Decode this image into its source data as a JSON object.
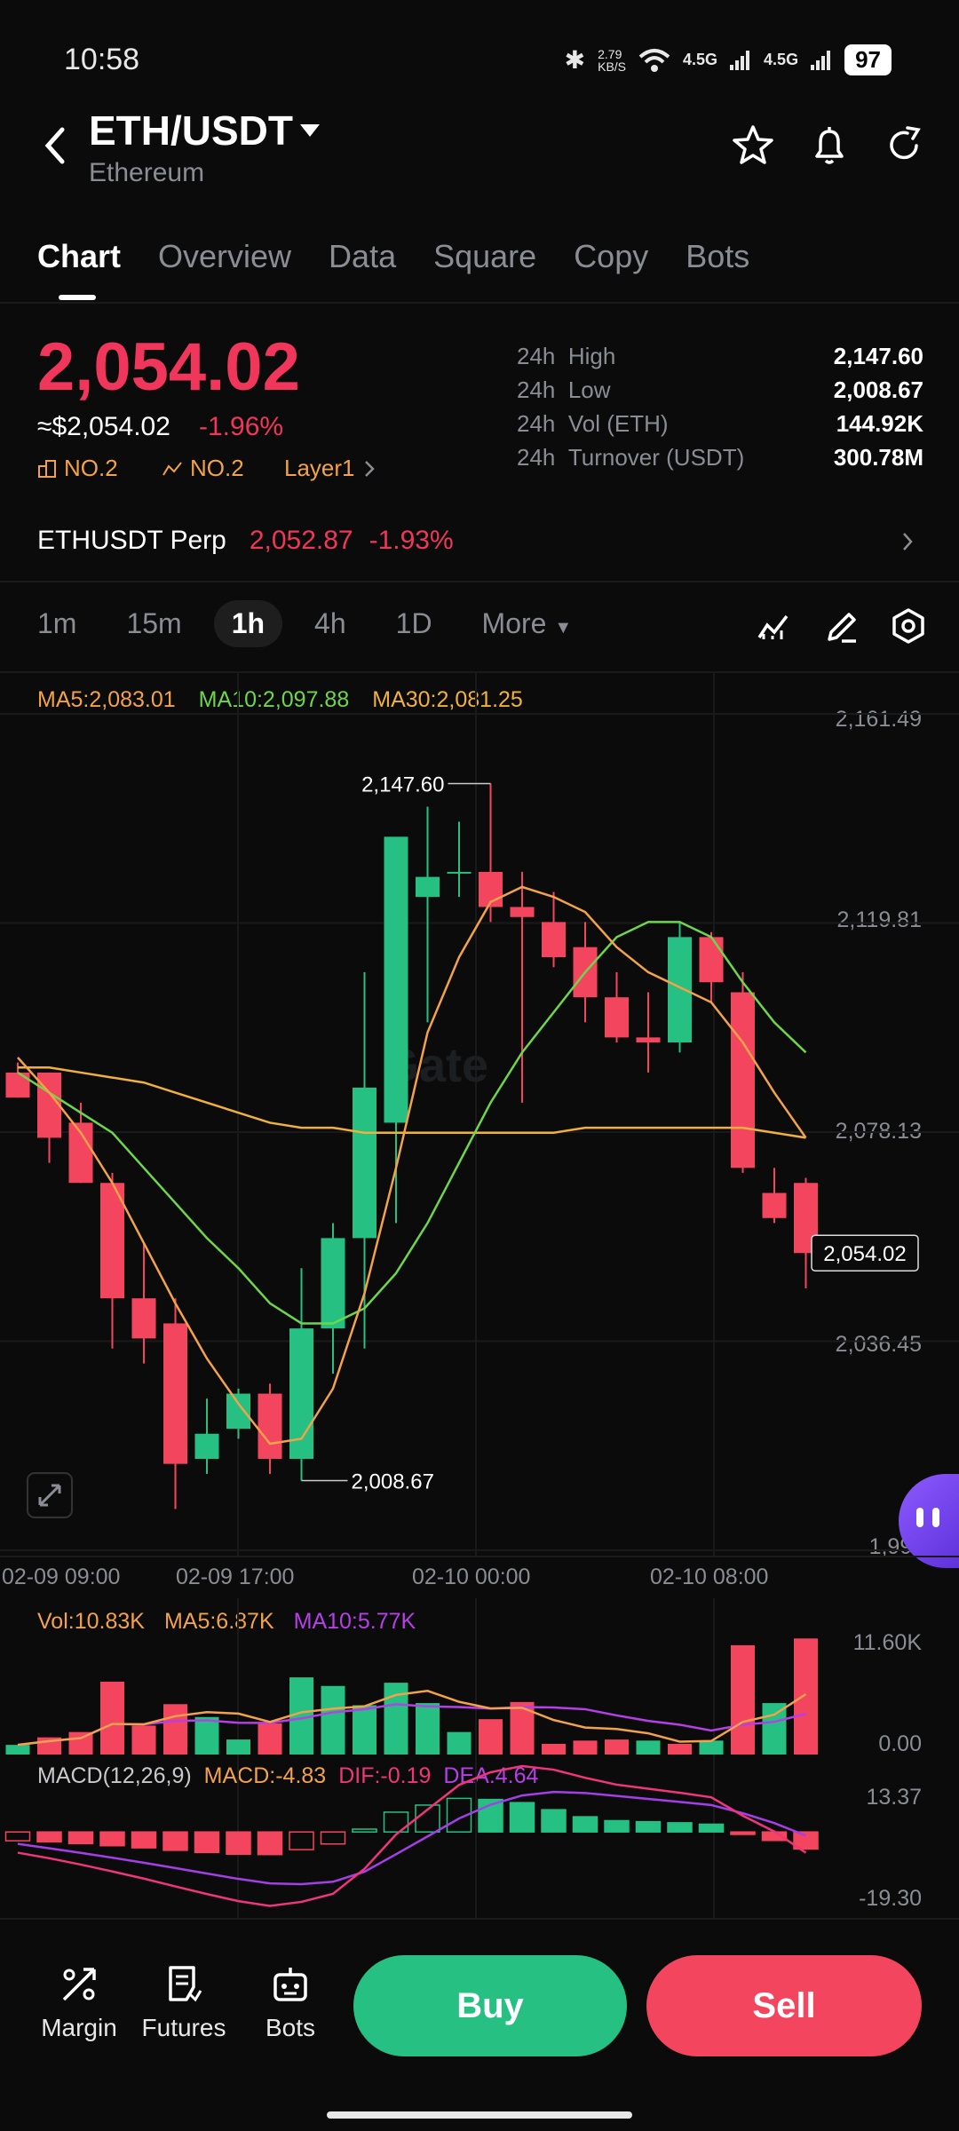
{
  "status_bar": {
    "time": "10:58",
    "speed": "2.79",
    "speed_unit": "KB/S",
    "network1": "4.5G",
    "network2": "4.5G",
    "battery": "97"
  },
  "header": {
    "pair": "ETH/USDT",
    "name": "Ethereum"
  },
  "tabs": [
    "Chart",
    "Overview",
    "Data",
    "Square",
    "Copy",
    "Bots"
  ],
  "active_tab": "Chart",
  "price": {
    "last": "2,054.02",
    "usd": "≈$2,054.02",
    "change": "-1.96%",
    "rank1": "NO.2",
    "rank2": "NO.2",
    "category": "Layer1"
  },
  "stats": [
    {
      "period": "24h",
      "label": "High",
      "value": "2,147.60"
    },
    {
      "period": "24h",
      "label": "Low",
      "value": "2,008.67"
    },
    {
      "period": "24h",
      "label": "Vol (ETH)",
      "value": "144.92K"
    },
    {
      "period": "24h",
      "label": "Turnover (USDT)",
      "value": "300.78M"
    }
  ],
  "perp": {
    "name": "ETHUSDT Perp",
    "price": "2,052.87",
    "change": "-1.93%"
  },
  "intervals": [
    "1m",
    "15m",
    "1h",
    "4h",
    "1D",
    "More"
  ],
  "active_interval": "1h",
  "ma_legend": {
    "ma5": "MA5:2,083.01",
    "ma10": "MA10:2,097.88",
    "ma30": "MA30:2,081.25"
  },
  "watermark": "Gate",
  "colors": {
    "up": "#25c082",
    "down": "#f4455f",
    "ma5": "#f2a24a",
    "ma10": "#6ed64a",
    "ma30": "#f0b13c",
    "dea": "#a43fe8",
    "dif": "#f0367a"
  },
  "chart_data": [
    {
      "type": "candlestick",
      "price_axis_ticks": [
        "2,161.49",
        "2,119.81",
        "2,078.13",
        "2,036.45",
        "1,994.7"
      ],
      "time_axis_ticks": [
        "02-09 09:00",
        "02-09 17:00",
        "02-10 00:00",
        "02-10 08:00"
      ],
      "ylim": [
        1994.77,
        2161.49
      ],
      "high_label": "2,147.60",
      "low_label": "2,008.67",
      "last_price_label": "2,054.02",
      "candles": [
        {
          "o": 2090,
          "h": 2092,
          "l": 2085,
          "c": 2085
        },
        {
          "o": 2090,
          "h": 2090,
          "l": 2072,
          "c": 2077
        },
        {
          "o": 2080,
          "h": 2084,
          "l": 2068,
          "c": 2068
        },
        {
          "o": 2068,
          "h": 2070,
          "l": 2035,
          "c": 2045
        },
        {
          "o": 2045,
          "h": 2056,
          "l": 2032,
          "c": 2037
        },
        {
          "o": 2040,
          "h": 2045,
          "l": 2003,
          "c": 2012
        },
        {
          "o": 2013,
          "h": 2025,
          "l": 2010,
          "c": 2018
        },
        {
          "o": 2019,
          "h": 2027,
          "l": 2017,
          "c": 2026
        },
        {
          "o": 2026,
          "h": 2028,
          "l": 2010,
          "c": 2013
        },
        {
          "o": 2013,
          "h": 2051,
          "l": 2008.67,
          "c": 2039
        },
        {
          "o": 2039,
          "h": 2060,
          "l": 2030,
          "c": 2057
        },
        {
          "o": 2057,
          "h": 2110,
          "l": 2035,
          "c": 2087
        },
        {
          "o": 2080,
          "h": 2136,
          "l": 2060,
          "c": 2137
        },
        {
          "o": 2125,
          "h": 2143,
          "l": 2100,
          "c": 2129
        },
        {
          "o": 2130,
          "h": 2140,
          "l": 2125,
          "c": 2130
        },
        {
          "o": 2130,
          "h": 2147.6,
          "l": 2120,
          "c": 2123
        },
        {
          "o": 2123,
          "h": 2130,
          "l": 2084,
          "c": 2121
        },
        {
          "o": 2120,
          "h": 2126,
          "l": 2111,
          "c": 2113
        },
        {
          "o": 2115,
          "h": 2120,
          "l": 2100,
          "c": 2105
        },
        {
          "o": 2105,
          "h": 2110,
          "l": 2096,
          "c": 2097
        },
        {
          "o": 2097,
          "h": 2106,
          "l": 2090,
          "c": 2096
        },
        {
          "o": 2096,
          "h": 2120,
          "l": 2094,
          "c": 2117
        },
        {
          "o": 2117,
          "h": 2118,
          "l": 2104,
          "c": 2108
        },
        {
          "o": 2106,
          "h": 2110,
          "l": 2070,
          "c": 2071
        },
        {
          "o": 2066,
          "h": 2071,
          "l": 2060,
          "c": 2061
        },
        {
          "o": 2068,
          "h": 2069,
          "l": 2047,
          "c": 2054.02
        }
      ],
      "ma5": [
        2093,
        2086,
        2078,
        2068,
        2056,
        2044,
        2033,
        2024,
        2016,
        2017,
        2027,
        2046,
        2071,
        2098,
        2113,
        2124,
        2127,
        2125,
        2122,
        2115,
        2110,
        2107,
        2104,
        2096,
        2086,
        2077
      ],
      "ma10": [
        2090,
        2086,
        2082,
        2078,
        2071,
        2064,
        2057,
        2051,
        2044,
        2040,
        2040,
        2043,
        2050,
        2060,
        2072,
        2084,
        2094,
        2102,
        2110,
        2117,
        2120,
        2120,
        2117,
        2108,
        2100,
        2094
      ],
      "ma30": [
        2091,
        2091,
        2090,
        2089,
        2088,
        2086,
        2084,
        2082,
        2080,
        2079,
        2079,
        2078,
        2078,
        2078,
        2078,
        2078,
        2078,
        2078,
        2079,
        2079,
        2079,
        2079,
        2079,
        2079,
        2078,
        2077
      ]
    },
    {
      "type": "bar",
      "title": "Vol:10.83K",
      "ma5_label": "MA5:6.87K",
      "ma10_label": "MA10:5.77K",
      "ticks": [
        "11.60K",
        "0.00"
      ],
      "ylim": [
        0,
        11.6
      ],
      "values": [
        0.9,
        1.6,
        2.1,
        6.8,
        2.7,
        4.7,
        3.5,
        1.4,
        2.9,
        7.2,
        6.4,
        4.6,
        6.7,
        4.8,
        2.1,
        3.3,
        4.9,
        1.0,
        1.3,
        1.4,
        1.3,
        1.0,
        1.3,
        10.2,
        4.8,
        10.83
      ],
      "direction": [
        "up",
        "down",
        "down",
        "down",
        "down",
        "down",
        "up",
        "up",
        "down",
        "up",
        "up",
        "up",
        "up",
        "up",
        "up",
        "down",
        "down",
        "down",
        "down",
        "down",
        "up",
        "down",
        "up",
        "down",
        "up",
        "down"
      ]
    },
    {
      "type": "bar",
      "title": "MACD(12,26,9)",
      "macd_label": "MACD:-4.83",
      "dif_label": "DIF:-0.19",
      "dea_label": "DEA:4.64",
      "ticks": [
        "13.37",
        "-19.30"
      ],
      "ylim": [
        -19.3,
        13.37
      ],
      "macd": [
        -2.5,
        -2.8,
        -3.3,
        -3.9,
        -4.5,
        -5.2,
        -5.8,
        -6.3,
        -6.4,
        -5.0,
        -3.4,
        0.8,
        5.6,
        7.6,
        9.5,
        9.2,
        8.3,
        6.3,
        4.3,
        3.2,
        2.9,
        2.6,
        2.2,
        -0.7,
        -2.4,
        -4.83
      ]
    }
  ],
  "bottom_nav": [
    {
      "label": "Margin"
    },
    {
      "label": "Futures"
    },
    {
      "label": "Bots"
    }
  ],
  "buttons": {
    "buy": "Buy",
    "sell": "Sell"
  }
}
